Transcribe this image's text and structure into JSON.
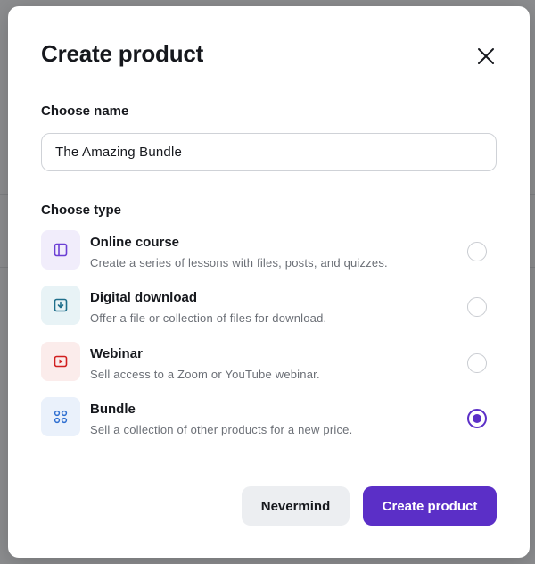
{
  "modal": {
    "title": "Create product",
    "name_section": {
      "label": "Choose name",
      "input_value": "The Amazing Bundle"
    },
    "type_section": {
      "label": "Choose type",
      "items": [
        {
          "title": "Online course",
          "description": "Create a series of lessons with files, posts, and quizzes.",
          "icon": "book-icon",
          "icon_color": "#6b3fd4",
          "icon_bg": "#f1edfb",
          "selected": false
        },
        {
          "title": "Digital download",
          "description": "Offer a file or collection of files for download.",
          "icon": "download-icon",
          "icon_color": "#1f6f8b",
          "icon_bg": "#e8f3f6",
          "selected": false
        },
        {
          "title": "Webinar",
          "description": "Sell access to a Zoom or YouTube webinar.",
          "icon": "video-play-icon",
          "icon_color": "#d11f1f",
          "icon_bg": "#fbeceb",
          "selected": false
        },
        {
          "title": "Bundle",
          "description": "Sell a collection of other products for a new price.",
          "icon": "grid-icon",
          "icon_color": "#2f6fd1",
          "icon_bg": "#eaf1fb",
          "selected": true
        }
      ]
    },
    "buttons": {
      "cancel_label": "Nevermind",
      "submit_label": "Create product"
    }
  },
  "colors": {
    "primary": "#5b2fc7",
    "overlay": "#8c8d8f"
  }
}
